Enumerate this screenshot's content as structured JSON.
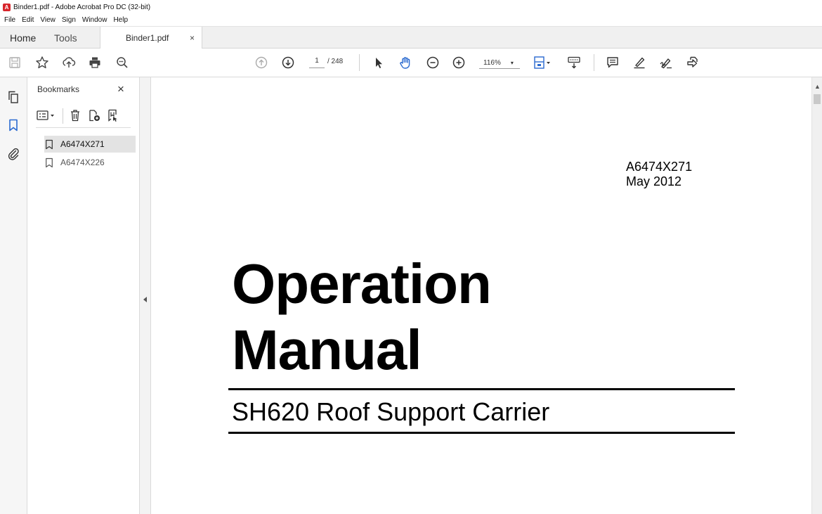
{
  "window": {
    "title": "Binder1.pdf - Adobe Acrobat Pro DC (32-bit)",
    "app_icon": "acrobat-icon"
  },
  "menu": [
    "File",
    "Edit",
    "View",
    "Sign",
    "Window",
    "Help"
  ],
  "tabs": {
    "home": "Home",
    "tools": "Tools",
    "document": "Binder1.pdf",
    "close": "×"
  },
  "toolbar": {
    "page_current": "1",
    "page_total": "/ 248",
    "zoom": "116%",
    "zoom_caret": "▾"
  },
  "bookmarks": {
    "title": "Bookmarks",
    "close": "×",
    "items": [
      {
        "label": "A6474X271",
        "selected": true
      },
      {
        "label": "A6474X226",
        "selected": false
      }
    ]
  },
  "document": {
    "doc_number": "A6474X271",
    "date": "May 2012",
    "title_line1": "Operation",
    "title_line2": "Manual",
    "subtitle": "SH620 Roof Support Carrier"
  },
  "colors": {
    "accent_blue": "#2a6ad0",
    "acrobat_red": "#d7262c"
  }
}
